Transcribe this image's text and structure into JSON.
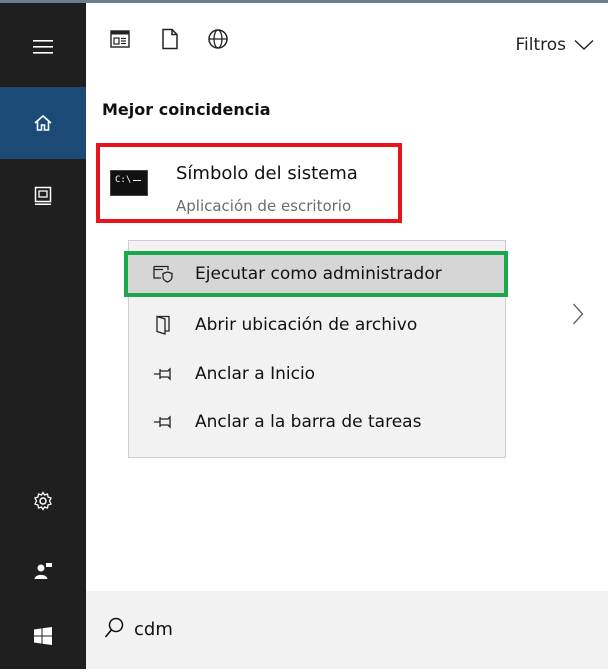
{
  "rail": {
    "items": [
      {
        "name": "menu",
        "icon": "hamburger-icon"
      },
      {
        "name": "home",
        "icon": "home-icon",
        "active": true
      },
      {
        "name": "documents",
        "icon": "document-viewer-icon"
      },
      {
        "name": "settings",
        "icon": "gear-icon"
      },
      {
        "name": "people",
        "icon": "people-icon"
      },
      {
        "name": "start",
        "icon": "windows-logo-icon"
      }
    ]
  },
  "toolbar": {
    "icons": [
      "apps-icon",
      "document-icon",
      "web-globe-icon"
    ],
    "filters_label": "Filtros"
  },
  "results": {
    "section_title": "Mejor coincidencia",
    "best_match": {
      "title": "Símbolo del sistema",
      "subtitle": "Aplicación de escritorio",
      "icon_text": "C:\\",
      "highlight_color": "#e8141c"
    }
  },
  "context_menu": {
    "items": [
      {
        "label": "Ejecutar como administrador",
        "icon": "admin-shield-icon",
        "highlighted": true,
        "highlight_color": "#1aa84a"
      },
      {
        "label": "Abrir ubicación de archivo",
        "icon": "open-folder-icon"
      },
      {
        "label": "Anclar a Inicio",
        "icon": "pin-icon"
      },
      {
        "label": "Anclar a la barra de tareas",
        "icon": "pin-icon"
      }
    ]
  },
  "search": {
    "query": "cdm"
  }
}
